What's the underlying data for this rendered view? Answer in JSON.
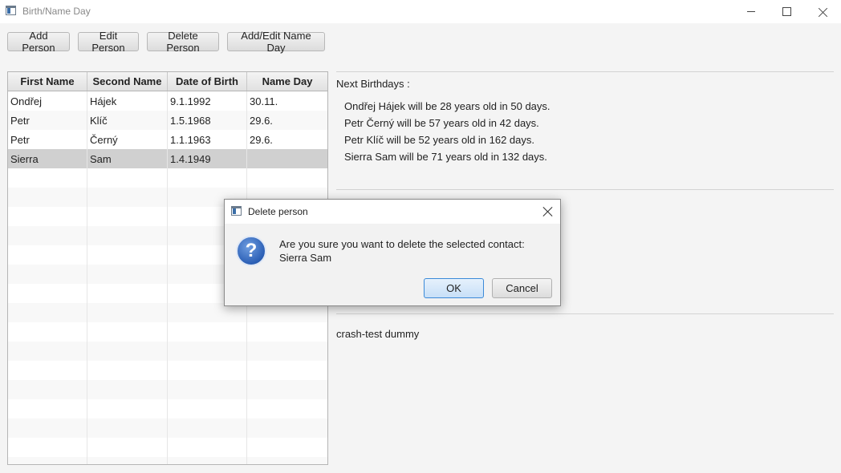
{
  "window": {
    "title": "Birth/Name Day"
  },
  "toolbar": {
    "add_label": "Add Person",
    "edit_label": "Edit Person",
    "delete_label": "Delete Person",
    "nameday_label": "Add/Edit Name Day"
  },
  "table": {
    "headers": [
      "First Name",
      "Second Name",
      "Date of Birth",
      "Name Day"
    ],
    "rows": [
      [
        "Ondřej",
        "Hájek",
        "9.1.1992",
        "30.11."
      ],
      [
        "Petr",
        "Klíč",
        "1.5.1968",
        "29.6."
      ],
      [
        "Petr",
        "Černý",
        "1.1.1963",
        "29.6."
      ],
      [
        "Sierra",
        "Sam",
        "1.4.1949",
        ""
      ]
    ],
    "selected_row": 3
  },
  "panel": {
    "next_birthdays_label": "Next Birthdays :",
    "birthdays": [
      "Ondřej Hájek will be 28 years old in 50 days.",
      "Petr Černý will be 57 years old in 42 days.",
      "Petr Klíč will be 52 years old in 162 days.",
      "Sierra Sam will be 71 years old in 132 days."
    ],
    "note": "crash-test dummy"
  },
  "dialog": {
    "title": "Delete person",
    "message": "Are you sure you want to delete the selected contact: Sierra Sam",
    "ok_label": "OK",
    "cancel_label": "Cancel",
    "icon": "question-icon"
  }
}
